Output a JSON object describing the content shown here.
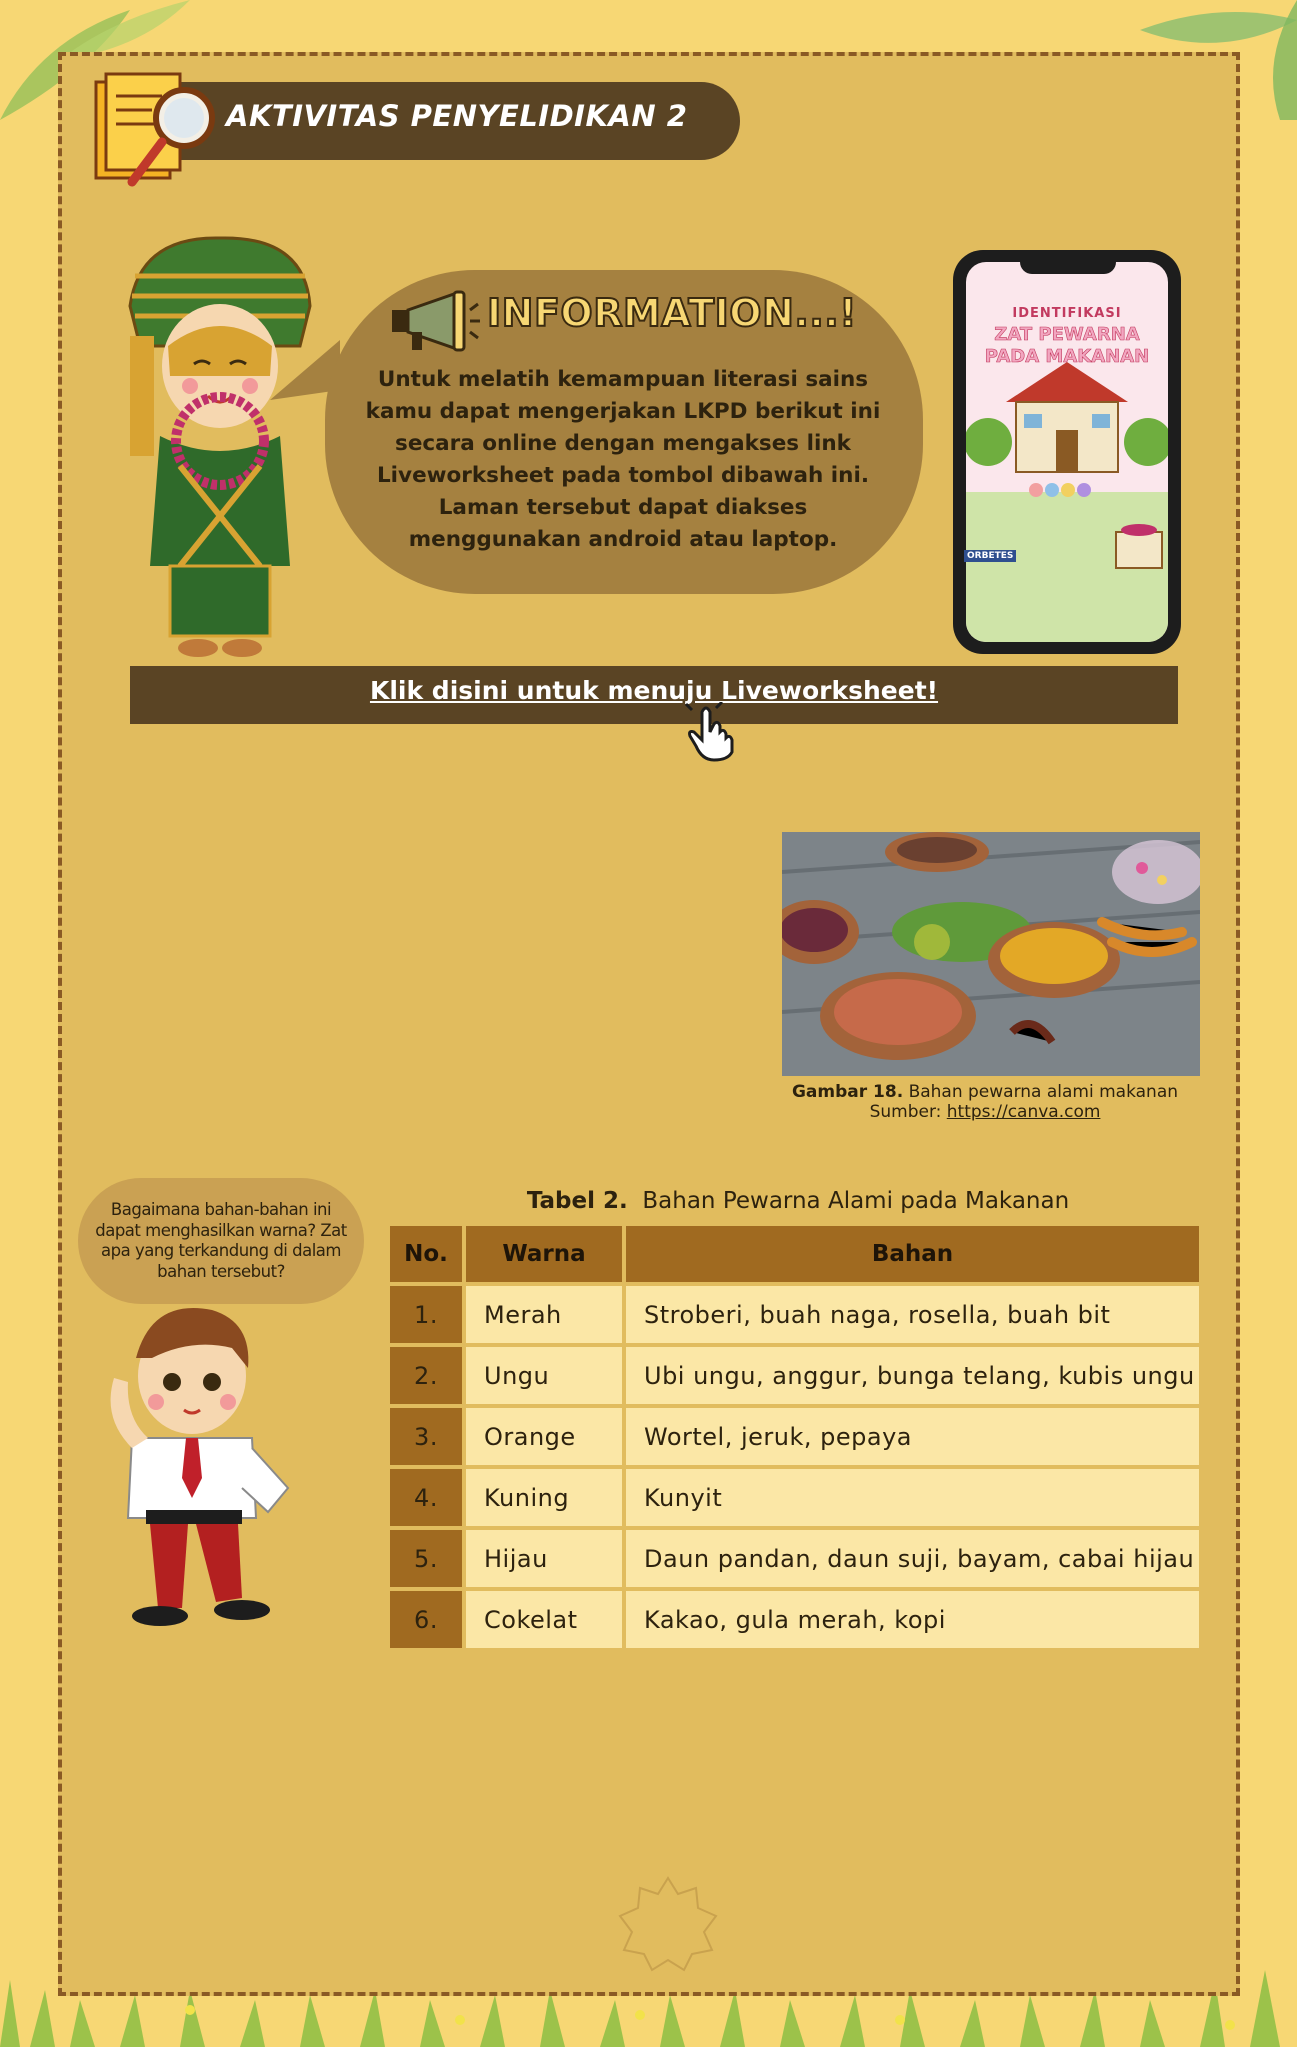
{
  "header": {
    "title": "AKTIVITAS PENYELIDIKAN 2"
  },
  "info": {
    "heading": "INFORMATION...!",
    "body": "Untuk melatih kemampuan literasi sains kamu dapat mengerjakan LKPD berikut ini secara online dengan mengakses link Liveworksheet pada tombol dibawah ini. Laman tersebut dapat diakses menggunakan android atau laptop."
  },
  "phone": {
    "line1": "IDENTIFIKASI",
    "line2": "ZAT PEWARNA PADA MAKANAN",
    "sign": "ORBETES"
  },
  "link": {
    "label": "Klik disini untuk menuju Liveworksheet!"
  },
  "figure": {
    "caption_label": "Gambar 18.",
    "caption_text": "Bahan pewarna alami makanan",
    "source_label": "Sumber:",
    "source_link": "https://canva.com"
  },
  "question": {
    "text": "Bagaimana bahan-bahan ini dapat menghasilkan warna? Zat apa yang terkandung di dalam bahan tersebut?"
  },
  "table": {
    "caption_label": "Tabel 2.",
    "caption_text": "Bahan Pewarna Alami pada Makanan",
    "headers": [
      "No.",
      "Warna",
      "Bahan"
    ],
    "rows": [
      {
        "no": "1.",
        "warna": "Merah",
        "bahan": "Stroberi, buah naga, rosella, buah bit"
      },
      {
        "no": "2.",
        "warna": "Ungu",
        "bahan": "Ubi ungu, anggur, bunga telang, kubis ungu"
      },
      {
        "no": "3.",
        "warna": "Orange",
        "bahan": "Wortel, jeruk, pepaya"
      },
      {
        "no": "4.",
        "warna": "Kuning",
        "bahan": "Kunyit"
      },
      {
        "no": "5.",
        "warna": "Hijau",
        "bahan": "Daun pandan, daun suji, bayam, cabai hijau"
      },
      {
        "no": "6.",
        "warna": "Cokelat",
        "bahan": "Kakao, gula merah, kopi"
      }
    ]
  },
  "colors": {
    "background": "#f7d774",
    "card": "#e1bc5e",
    "dark_brown": "#5a4424",
    "table_header": "#a06a20",
    "table_cell": "#fbe7a6"
  }
}
